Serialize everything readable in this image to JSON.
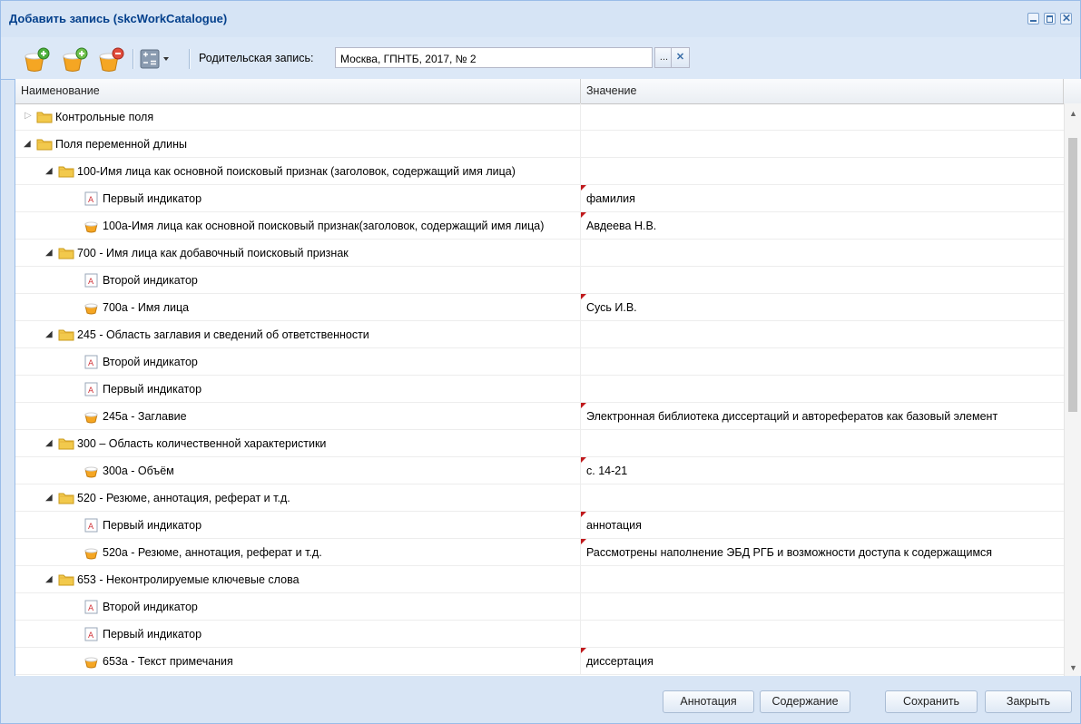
{
  "window": {
    "title": "Добавить запись (skcWorkCatalogue)"
  },
  "toolbar": {
    "add_icon": "add-record-icon",
    "add_child_icon": "add-child-record-icon",
    "delete_icon": "delete-record-icon",
    "calc_icon": "calculator-icon",
    "parent_label": "Родительская запись:",
    "parent_value": "Москва, ГПНТБ, 2017, № 2",
    "browse_label": "...",
    "clear_label": "✕"
  },
  "grid": {
    "columns": [
      "Наименование",
      "Значение"
    ],
    "rows": [
      {
        "name": "Контрольные поля",
        "value": "",
        "icon": "folder-icon",
        "level": 0,
        "expander": "collapsed",
        "dirty": false
      },
      {
        "name": "Поля переменной длины",
        "value": "",
        "icon": "folder-icon",
        "level": 0,
        "expander": "expanded",
        "dirty": false
      },
      {
        "name": "100-Имя лица как основной поисковый признак (заголовок, содержащий имя лица)",
        "value": "",
        "icon": "folder-icon",
        "level": 1,
        "expander": "expanded",
        "dirty": false
      },
      {
        "name": "Первый индикатор",
        "value": "фамилия",
        "icon": "indicator-icon",
        "level": 2,
        "expander": "",
        "dirty": true
      },
      {
        "name": "100a-Имя лица как основной поисковый признак(заголовок, содержащий имя лица)",
        "value": "Авдеева Н.В.",
        "icon": "subfield-icon",
        "level": 2,
        "expander": "",
        "dirty": true
      },
      {
        "name": "700 - Имя лица как добавочный поисковый признак",
        "value": "",
        "icon": "folder-icon",
        "level": 1,
        "expander": "expanded",
        "dirty": false
      },
      {
        "name": "Второй индикатор",
        "value": "",
        "icon": "indicator-icon",
        "level": 2,
        "expander": "",
        "dirty": false
      },
      {
        "name": "700a - Имя лица",
        "value": "Сусь И.В.",
        "icon": "subfield-icon",
        "level": 2,
        "expander": "",
        "dirty": true
      },
      {
        "name": "245 - Область заглавия и сведений об ответственности",
        "value": "",
        "icon": "folder-icon",
        "level": 1,
        "expander": "expanded",
        "dirty": false
      },
      {
        "name": "Второй индикатор",
        "value": "",
        "icon": "indicator-icon",
        "level": 2,
        "expander": "",
        "dirty": false
      },
      {
        "name": "Первый индикатор",
        "value": "",
        "icon": "indicator-icon",
        "level": 2,
        "expander": "",
        "dirty": false
      },
      {
        "name": "245a - Заглавие",
        "value": "Электронная библиотека диссертаций и авторефератов как базовый элемент",
        "icon": "subfield-icon",
        "level": 2,
        "expander": "",
        "dirty": true
      },
      {
        "name": "300 – Область количественной характеристики",
        "value": "",
        "icon": "folder-icon",
        "level": 1,
        "expander": "expanded",
        "dirty": false
      },
      {
        "name": "300a - Объём",
        "value": "с. 14-21",
        "icon": "subfield-icon",
        "level": 2,
        "expander": "",
        "dirty": true
      },
      {
        "name": "520 - Резюме, аннотация, реферат и т.д.",
        "value": "",
        "icon": "folder-icon",
        "level": 1,
        "expander": "expanded",
        "dirty": false
      },
      {
        "name": "Первый индикатор",
        "value": "аннотация",
        "icon": "indicator-icon",
        "level": 2,
        "expander": "",
        "dirty": true
      },
      {
        "name": "520a - Резюме, аннотация, реферат и т.д.",
        "value": "Рассмотрены наполнение ЭБД РГБ и возможности доступа к содержащимся",
        "icon": "subfield-icon",
        "level": 2,
        "expander": "",
        "dirty": true
      },
      {
        "name": "653 - Неконтролируемые ключевые слова",
        "value": "",
        "icon": "folder-icon",
        "level": 1,
        "expander": "expanded",
        "dirty": false
      },
      {
        "name": "Второй индикатор",
        "value": "",
        "icon": "indicator-icon",
        "level": 2,
        "expander": "",
        "dirty": false
      },
      {
        "name": "Первый индикатор",
        "value": "",
        "icon": "indicator-icon",
        "level": 2,
        "expander": "",
        "dirty": false
      },
      {
        "name": "653a - Текст примечания",
        "value": "диссертация",
        "icon": "subfield-icon",
        "level": 2,
        "expander": "",
        "dirty": true
      }
    ]
  },
  "footer": {
    "annotation": "Аннотация",
    "contents": "Содержание",
    "save": "Сохранить",
    "close": "Закрыть"
  },
  "colors": {
    "title": "#04408c",
    "window_bg": "#d8e5f5",
    "dirty_marker": "#c0191c",
    "folder": "#f2c94c"
  }
}
